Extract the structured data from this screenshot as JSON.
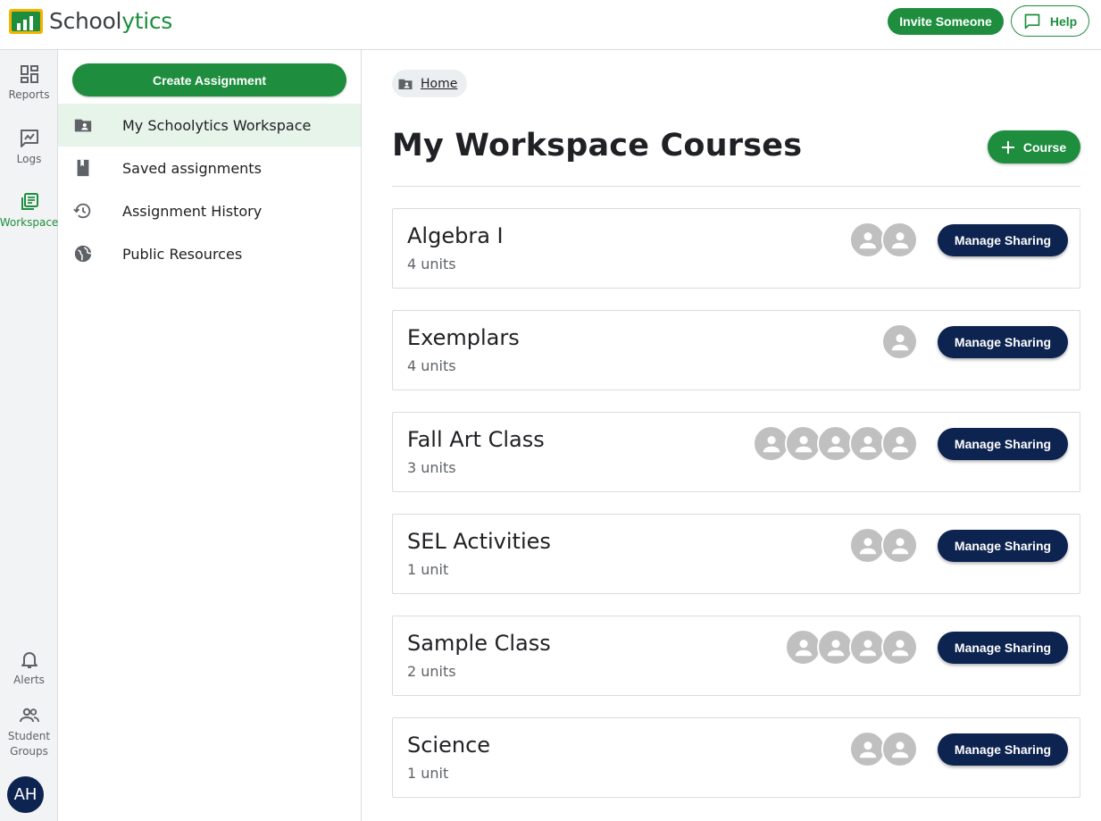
{
  "header": {
    "brand_prefix": "School",
    "brand_suffix": "ytics",
    "invite_label": "Invite Someone",
    "help_label": "Help"
  },
  "rail": {
    "items": [
      {
        "label": "Reports",
        "icon": "dashboard-icon"
      },
      {
        "label": "Logs",
        "icon": "chat-log-icon"
      },
      {
        "label": "Workspace",
        "icon": "library-icon",
        "active": true
      },
      {
        "label": "Alerts",
        "icon": "bell-icon"
      },
      {
        "label": "Student Groups",
        "icon": "people-icon"
      }
    ],
    "avatar_initials": "AH"
  },
  "sidebar": {
    "create_label": "Create Assignment",
    "items": [
      {
        "label": "My Schoolytics Workspace",
        "icon": "shared-folder-icon",
        "active": true
      },
      {
        "label": "Saved assignments",
        "icon": "book-icon"
      },
      {
        "label": "Assignment History",
        "icon": "history-icon"
      },
      {
        "label": "Public Resources",
        "icon": "globe-icon"
      }
    ]
  },
  "main": {
    "breadcrumb": "Home",
    "title": "My Workspace Courses",
    "add_course_label": "Course",
    "manage_label": "Manage Sharing",
    "courses": [
      {
        "name": "Algebra I",
        "units": "4 units",
        "shared_count": 2
      },
      {
        "name": "Exemplars",
        "units": "4 units",
        "shared_count": 1
      },
      {
        "name": "Fall Art Class",
        "units": "3 units",
        "shared_count": 5
      },
      {
        "name": "SEL Activities",
        "units": "1 unit",
        "shared_count": 2
      },
      {
        "name": "Sample Class",
        "units": "2 units",
        "shared_count": 4
      },
      {
        "name": "Science",
        "units": "1 unit",
        "shared_count": 2
      }
    ]
  },
  "colors": {
    "brand_green": "#1e8e3e",
    "navy": "#0d2350",
    "logo_yellow": "#f4b400"
  }
}
